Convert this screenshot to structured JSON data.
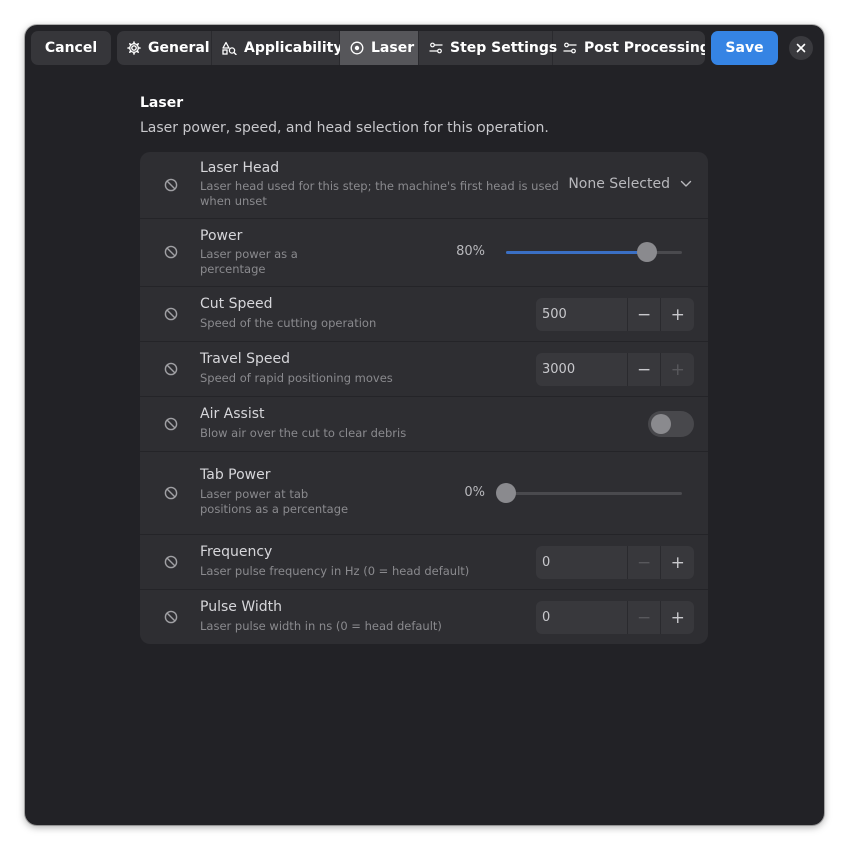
{
  "header": {
    "cancel_label": "Cancel",
    "save_label": "Save",
    "tabs": [
      {
        "label": "General",
        "icon": "gear-icon",
        "active": false
      },
      {
        "label": "Applicability",
        "icon": "applicability-icon",
        "active": false
      },
      {
        "label": "Laser",
        "icon": "laser-target-icon",
        "active": true
      },
      {
        "label": "Step Settings",
        "icon": "sliders-icon",
        "active": false
      },
      {
        "label": "Post Processing",
        "icon": "sliders-icon",
        "active": false
      }
    ]
  },
  "section": {
    "title": "Laser",
    "description": "Laser power, speed, and head selection for this operation."
  },
  "rows": {
    "laser_head": {
      "title": "Laser Head",
      "subtitle_line1": "Laser head used for this step; the machine's first head is used",
      "subtitle_line2": "when unset",
      "value": "None Selected"
    },
    "power": {
      "title": "Power",
      "subtitle_line1": "Laser power as a",
      "subtitle_line2": "percentage",
      "value_label": "80%",
      "value": 0.8
    },
    "cut_speed": {
      "title": "Cut Speed",
      "subtitle": "Speed of the cutting operation",
      "value": "500"
    },
    "travel_speed": {
      "title": "Travel Speed",
      "subtitle": "Speed of rapid positioning moves",
      "value": "3000"
    },
    "air_assist": {
      "title": "Air Assist",
      "subtitle": "Blow air over the cut to clear debris",
      "enabled": false
    },
    "tab_power": {
      "title": "Tab Power",
      "subtitle_line1": "Laser power at tab",
      "subtitle_line2": "positions as a percentage",
      "value_label": "0%",
      "value": 0.0
    },
    "frequency": {
      "title": "Frequency",
      "subtitle": "Laser pulse frequency in Hz (0 = head default)",
      "value": "0"
    },
    "pulse_width": {
      "title": "Pulse Width",
      "subtitle": "Laser pulse width in ns (0 = head default)",
      "value": "0"
    }
  },
  "glyphs": {
    "minus": "−",
    "plus": "+"
  },
  "colors": {
    "accent": "#3584e4",
    "slider_fill": "#3a6fc4",
    "window_bg": "#222226",
    "card_bg": "#2e2e32"
  }
}
